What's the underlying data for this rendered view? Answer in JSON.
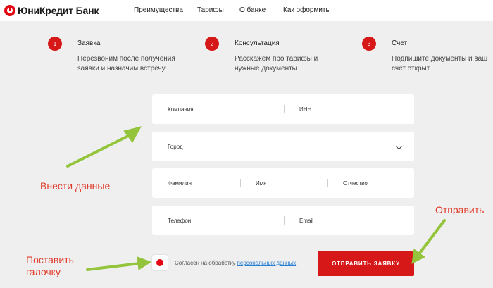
{
  "brand": {
    "name": "ЮниКредит Банк",
    "accent_color": "#d61818",
    "arrow_color": "#94c43c"
  },
  "nav": {
    "items": [
      "Преимущества",
      "Тарифы",
      "О банке",
      "Как оформить"
    ]
  },
  "steps": [
    {
      "number": "1",
      "title": "Заявка",
      "description": "Перезвоним после получения заявки и назначим встречу"
    },
    {
      "number": "2",
      "title": "Консультация",
      "description": "Расскажем про тарифы и нужные документы"
    },
    {
      "number": "3",
      "title": "Счет",
      "description": "Подпишите документы и ваш счет открыт"
    }
  ],
  "form": {
    "company": "Компания",
    "inn": "ИНН",
    "city": "Город",
    "last_name": "Фамилия",
    "first_name": "Имя",
    "patronymic": "Отчество",
    "phone": "Телефон",
    "email": "Email"
  },
  "consent": {
    "text": "Согласен на обработку ",
    "link": "персональных данных",
    "checked": true
  },
  "submit_label": "ОТПРАВИТЬ ЗАЯВКУ",
  "annotations": {
    "enter_data": "Внести данные",
    "check_box_line1": "Поставить",
    "check_box_line2": "галочку",
    "send": "Отправить"
  }
}
